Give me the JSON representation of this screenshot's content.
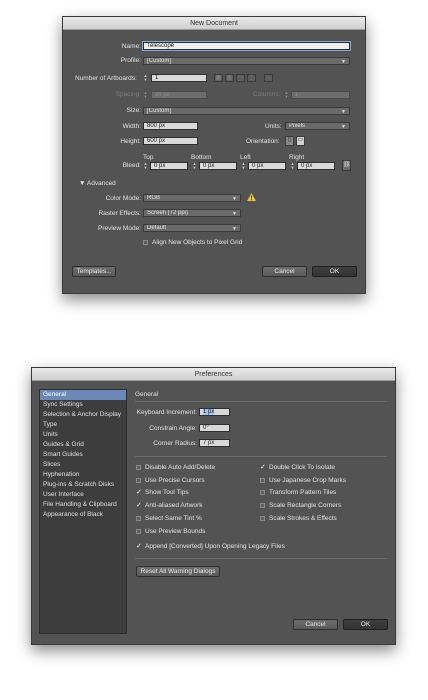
{
  "new_document": {
    "title": "New Document",
    "name_label": "Name:",
    "name_value": "Telescope",
    "profile_label": "Profile:",
    "profile_value": "[Custom]",
    "artboards_label": "Number of Artboards:",
    "artboards_value": "1",
    "spacing_label": "Spacing:",
    "spacing_value": "20 px",
    "columns_label": "Columns:",
    "columns_value": "1",
    "size_label": "Size:",
    "size_value": "[Custom]",
    "width_label": "Width:",
    "width_value": "800 px",
    "units_label": "Units:",
    "units_value": "Pixels",
    "height_label": "Height:",
    "height_value": "600 px",
    "orientation_label": "Orientation:",
    "bleed_label": "Bleed:",
    "bleed_headers": [
      "Top",
      "Bottom",
      "Left",
      "Right"
    ],
    "bleed_values": [
      "0 px",
      "0 px",
      "0 px",
      "0 px"
    ],
    "advanced_label": "Advanced",
    "color_mode_label": "Color Mode:",
    "color_mode_value": "RGB",
    "raster_label": "Raster Effects:",
    "raster_value": "Screen (72 ppi)",
    "preview_label": "Preview Mode:",
    "preview_value": "Default",
    "align_label": "Align New Objects to Pixel Grid",
    "templates_button": "Templates...",
    "cancel_button": "Cancel",
    "ok_button": "OK"
  },
  "preferences": {
    "title": "Preferences",
    "sidebar_items": [
      "General",
      "Sync Settings",
      "Selection & Anchor Display",
      "Type",
      "Units",
      "Guides & Grid",
      "Smart Guides",
      "Slices",
      "Hyphenation",
      "Plug-ins & Scratch Disks",
      "User Interface",
      "File Handling & Clipboard",
      "Appearance of Black"
    ],
    "section_title": "General",
    "keyboard_increment_label": "Keyboard Increment:",
    "keyboard_increment_value": "1 px",
    "constrain_angle_label": "Constrain Angle:",
    "constrain_angle_value": "0°",
    "corner_radius_label": "Corner Radius:",
    "corner_radius_value": "7 px",
    "left_options": [
      {
        "label": "Disable Auto Add/Delete",
        "checked": false
      },
      {
        "label": "Use Precise Cursors",
        "checked": false
      },
      {
        "label": "Show Tool Tips",
        "checked": true
      },
      {
        "label": "Anti-aliased Artwork",
        "checked": true
      },
      {
        "label": "Select Same Tint %",
        "checked": false
      },
      {
        "label": "Use Preview Bounds",
        "checked": false
      }
    ],
    "right_options": [
      {
        "label": "Double Click To Isolate",
        "checked": true
      },
      {
        "label": "Use Japanese Crop Marks",
        "checked": false
      },
      {
        "label": "Transform Pattern Tiles",
        "checked": false
      },
      {
        "label": "Scale Rectangle Corners",
        "checked": false
      },
      {
        "label": "Scale Strokes & Effects",
        "checked": false
      }
    ],
    "append_option": {
      "label": "Append [Converted] Upon Opening Legacy Files",
      "checked": true
    },
    "reset_button": "Reset All Warning Dialogs",
    "cancel_button": "Cancel",
    "ok_button": "OK"
  },
  "colors": {
    "dialog_bg": "#535353",
    "sidebar_bg": "#3d3d3d",
    "selection": "#6a88b8",
    "warning": "#f0c419"
  }
}
